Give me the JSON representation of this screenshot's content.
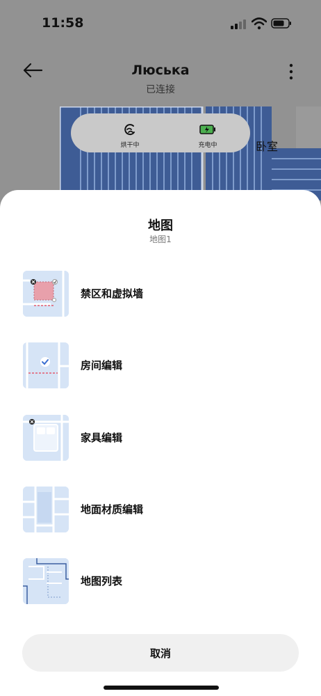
{
  "status_bar": {
    "time": "11:58"
  },
  "header": {
    "title": "Люська",
    "subtitle": "已连接"
  },
  "device_status": {
    "drying": {
      "label": "烘干中"
    },
    "charging": {
      "label": "充电中"
    }
  },
  "map": {
    "room_label": "卧室"
  },
  "sheet": {
    "title": "地图",
    "subtitle": "地图1",
    "items": [
      {
        "label": "禁区和虚拟墙",
        "icon": "no-go-zone-icon"
      },
      {
        "label": "房间编辑",
        "icon": "room-edit-icon"
      },
      {
        "label": "家具编辑",
        "icon": "furniture-edit-icon"
      },
      {
        "label": "地面材质编辑",
        "icon": "floor-material-icon"
      },
      {
        "label": "地图列表",
        "icon": "map-list-icon"
      }
    ],
    "cancel_label": "取消"
  },
  "colors": {
    "map_blue": "#4a6aa8",
    "thumb_bg": "#d6e4f6",
    "no_go_red": "#e8a0ab",
    "charging_green": "#4caf50"
  }
}
